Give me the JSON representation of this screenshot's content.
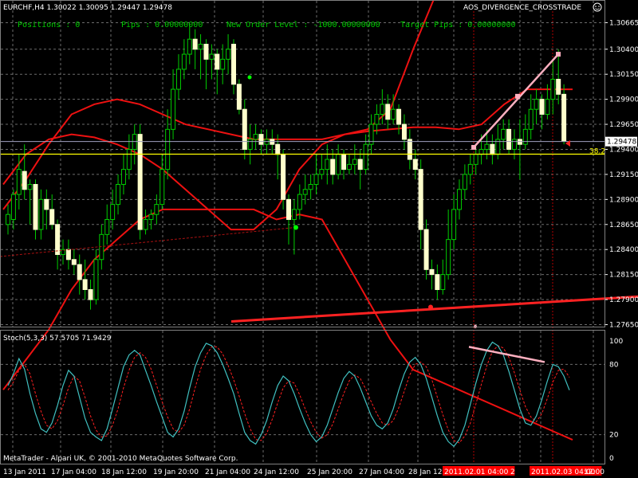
{
  "header": {
    "symbol_info": "EURCHF,H4  1.30022 1.30095 1.29447 1.29478",
    "indicator_name": "AOS_DIVERGENCE_CROSSTRADE",
    "positions": "Positions : 0",
    "pips": "Pips : 0.00000000",
    "new_order_level": "New Order Level : -1000.00000000",
    "target_pips": "Target Pips : 0.00000000"
  },
  "sub_window": {
    "label": "Stoch(5,3,3) 57.5705 71.9429"
  },
  "copyright": "MetaTrader - Alpari UK, © 2001-2010 MetaQuotes Software Corp.",
  "fib_label": "38.2",
  "chart_data": {
    "type": "candlestick",
    "price_axis": {
      "labels": [
        "1.30665",
        "1.30400",
        "1.30150",
        "1.29900",
        "1.29650",
        "1.29400",
        "1.29150",
        "1.28900",
        "1.28650",
        "1.28400",
        "1.28150",
        "1.27900",
        "1.27650"
      ],
      "range": [
        1.2763,
        1.3078
      ]
    },
    "current_price": "1.29478",
    "time_axis": {
      "labels": [
        "13 Jan 2011",
        "17 Jan 04:00",
        "18 Jan 12:00",
        "19 Jan 20:00",
        "21 Jan 04:00",
        "24 Jan 12:00",
        "25 Jan 20:00",
        "27 Jan 04:00",
        "28 Jan 12:00",
        "2011.02.01 04:00",
        "2",
        "2011.02.03 04:00",
        "12:00"
      ],
      "highlighted": [
        "2011.02.01 04:00",
        "2011.02.03 04:00"
      ]
    },
    "stoch_axis": {
      "labels": [
        "100",
        "80",
        "20",
        "0"
      ],
      "range": [
        0,
        100
      ]
    },
    "candles": [
      [
        1.2865,
        1.2875,
        1.2885,
        1.2855
      ],
      [
        1.287,
        1.2895,
        1.29,
        1.286
      ],
      [
        1.2895,
        1.292,
        1.2935,
        1.288
      ],
      [
        1.2918,
        1.29,
        1.2945,
        1.289
      ],
      [
        1.29,
        1.2905,
        1.291,
        1.2865
      ],
      [
        1.2905,
        1.286,
        1.291,
        1.285
      ],
      [
        1.286,
        1.289,
        1.29,
        1.285
      ],
      [
        1.289,
        1.288,
        1.29,
        1.286
      ],
      [
        1.288,
        1.2865,
        1.2895,
        1.286
      ],
      [
        1.2865,
        1.2835,
        1.287,
        1.282
      ],
      [
        1.2835,
        1.284,
        1.285,
        1.2825
      ],
      [
        1.284,
        1.283,
        1.285,
        1.282
      ],
      [
        1.283,
        1.2825,
        1.284,
        1.2815
      ],
      [
        1.2825,
        1.281,
        1.2835,
        1.2795
      ],
      [
        1.281,
        1.28,
        1.283,
        1.279
      ],
      [
        1.28,
        1.279,
        1.281,
        1.278
      ],
      [
        1.279,
        1.283,
        1.284,
        1.2785
      ],
      [
        1.283,
        1.2855,
        1.2865,
        1.282
      ],
      [
        1.2855,
        1.287,
        1.2885,
        1.2845
      ],
      [
        1.287,
        1.2885,
        1.29,
        1.286
      ],
      [
        1.2885,
        1.2905,
        1.2915,
        1.2875
      ],
      [
        1.2905,
        1.292,
        1.2935,
        1.2895
      ],
      [
        1.292,
        1.294,
        1.2955,
        1.291
      ],
      [
        1.294,
        1.2955,
        1.2965,
        1.2925
      ],
      [
        1.2955,
        1.286,
        1.2965,
        1.285
      ],
      [
        1.286,
        1.287,
        1.288,
        1.2855
      ],
      [
        1.287,
        1.2875,
        1.288,
        1.286
      ],
      [
        1.2875,
        1.2885,
        1.2895,
        1.2865
      ],
      [
        1.2885,
        1.292,
        1.2935,
        1.288
      ],
      [
        1.292,
        1.296,
        1.298,
        1.291
      ],
      [
        1.296,
        1.3,
        1.302,
        1.295
      ],
      [
        1.3,
        1.302,
        1.3035,
        1.299
      ],
      [
        1.302,
        1.3035,
        1.305,
        1.301
      ],
      [
        1.3035,
        1.305,
        1.3065,
        1.3025
      ],
      [
        1.305,
        1.304,
        1.306,
        1.302
      ],
      [
        1.304,
        1.3045,
        1.3055,
        1.301
      ],
      [
        1.3045,
        1.303,
        1.305,
        1.3
      ],
      [
        1.303,
        1.3035,
        1.3045,
        1.301
      ],
      [
        1.3035,
        1.302,
        1.304,
        1.2995
      ],
      [
        1.302,
        1.303,
        1.3045,
        1.3005
      ],
      [
        1.303,
        1.304,
        1.3055,
        1.3015
      ],
      [
        1.3045,
        1.3005,
        1.305,
        1.2995
      ],
      [
        1.3005,
        1.298,
        1.301,
        1.2975
      ],
      [
        1.298,
        1.294,
        1.299,
        1.293
      ],
      [
        1.294,
        1.295,
        1.2965,
        1.2925
      ],
      [
        1.295,
        1.2955,
        1.2965,
        1.294
      ],
      [
        1.2955,
        1.2945,
        1.296,
        1.2935
      ],
      [
        1.2945,
        1.295,
        1.296,
        1.2935
      ],
      [
        1.295,
        1.2945,
        1.296,
        1.2935
      ],
      [
        1.2945,
        1.2935,
        1.2955,
        1.291
      ],
      [
        1.2935,
        1.289,
        1.294,
        1.288
      ],
      [
        1.289,
        1.287,
        1.2895,
        1.2845
      ],
      [
        1.287,
        1.288,
        1.289,
        1.2835
      ],
      [
        1.288,
        1.2895,
        1.2905,
        1.287
      ],
      [
        1.2895,
        1.29,
        1.2915,
        1.2885
      ],
      [
        1.29,
        1.2905,
        1.2915,
        1.289
      ],
      [
        1.2905,
        1.2915,
        1.2935,
        1.2895
      ],
      [
        1.2915,
        1.292,
        1.2935,
        1.291
      ],
      [
        1.292,
        1.293,
        1.2945,
        1.2905
      ],
      [
        1.293,
        1.2915,
        1.294,
        1.2905
      ],
      [
        1.2915,
        1.2935,
        1.2945,
        1.291
      ],
      [
        1.2935,
        1.292,
        1.294,
        1.291
      ],
      [
        1.292,
        1.2925,
        1.2935,
        1.2915
      ],
      [
        1.2925,
        1.293,
        1.2945,
        1.2915
      ],
      [
        1.293,
        1.292,
        1.294,
        1.29
      ],
      [
        1.292,
        1.2945,
        1.2955,
        1.2915
      ],
      [
        1.2945,
        1.2965,
        1.2975,
        1.2935
      ],
      [
        1.2965,
        1.2975,
        1.2985,
        1.2955
      ],
      [
        1.2975,
        1.2985,
        1.3,
        1.2965
      ],
      [
        1.2985,
        1.297,
        1.2995,
        1.296
      ],
      [
        1.297,
        1.298,
        1.2995,
        1.2965
      ],
      [
        1.298,
        1.2965,
        1.2985,
        1.2955
      ],
      [
        1.2965,
        1.295,
        1.2975,
        1.294
      ],
      [
        1.295,
        1.293,
        1.296,
        1.292
      ],
      [
        1.293,
        1.292,
        1.294,
        1.291
      ],
      [
        1.292,
        1.286,
        1.293,
        1.284
      ],
      [
        1.286,
        1.282,
        1.287,
        1.281
      ],
      [
        1.282,
        1.2815,
        1.283,
        1.28
      ],
      [
        1.2815,
        1.28,
        1.2825,
        1.279
      ],
      [
        1.28,
        1.2815,
        1.283,
        1.2795
      ],
      [
        1.2815,
        1.285,
        1.288,
        1.281
      ],
      [
        1.285,
        1.288,
        1.2895,
        1.284
      ],
      [
        1.288,
        1.29,
        1.291,
        1.287
      ],
      [
        1.29,
        1.2915,
        1.2925,
        1.289
      ],
      [
        1.2915,
        1.2925,
        1.2935,
        1.2905
      ],
      [
        1.2925,
        1.2935,
        1.2945,
        1.2915
      ],
      [
        1.2935,
        1.294,
        1.2955,
        1.2925
      ],
      [
        1.294,
        1.2945,
        1.296,
        1.293
      ],
      [
        1.2945,
        1.2935,
        1.2955,
        1.2925
      ],
      [
        1.2935,
        1.295,
        1.2965,
        1.293
      ],
      [
        1.295,
        1.296,
        1.297,
        1.294
      ],
      [
        1.296,
        1.294,
        1.297,
        1.2935
      ],
      [
        1.294,
        1.295,
        1.296,
        1.293
      ],
      [
        1.295,
        1.2945,
        1.297,
        1.291
      ],
      [
        1.2945,
        1.296,
        1.2975,
        1.294
      ],
      [
        1.296,
        1.298,
        1.2995,
        1.295
      ],
      [
        1.298,
        1.299,
        1.3,
        1.2965
      ],
      [
        1.299,
        1.2975,
        1.2995,
        1.296
      ],
      [
        1.2975,
        1.299,
        1.3005,
        1.297
      ],
      [
        1.299,
        1.301,
        1.303,
        1.2975
      ],
      [
        1.301,
        1.2995,
        1.304,
        1.2985
      ],
      [
        1.2995,
        1.2948,
        1.3005,
        1.2945
      ]
    ],
    "upper_band": [
      1.288,
      1.291,
      1.2945,
      1.2975,
      1.2985,
      1.299,
      1.2985,
      1.2975,
      1.2965,
      1.296,
      1.2955,
      1.295,
      1.295,
      1.295,
      1.295,
      1.2955,
      1.296,
      1.298,
      1.304,
      1.3095,
      1.315,
      1.32,
      1.325,
      1.331,
      1.336,
      1.342
    ],
    "middle_band": [
      1.2905,
      1.2935,
      1.295,
      1.2955,
      1.2952,
      1.2945,
      1.2935,
      1.292,
      1.29,
      1.288,
      1.286,
      1.286,
      1.288,
      1.292,
      1.2945,
      1.2955,
      1.2958,
      1.296,
      1.2962,
      1.2962,
      1.296,
      1.2965,
      1.2985,
      1.3,
      1.3,
      1.3
    ],
    "lower_band": [
      1.27,
      1.273,
      1.276,
      1.28,
      1.283,
      1.285,
      1.287,
      1.288,
      1.288,
      1.288,
      1.288,
      1.288,
      1.287,
      1.2875,
      1.287,
      1.283,
      1.279,
      1.275,
      1.272,
      1.271,
      1.27,
      1.269,
      1.268,
      1.267,
      1.266,
      1.265
    ],
    "trend_line": [
      [
        0,
        1.2765
      ],
      [
        102,
        1.2793
      ]
    ],
    "divergence_price": [
      [
        78,
        1.2942
      ],
      [
        101,
        1.3035
      ]
    ],
    "divergence_stoch": [
      [
        78,
        95
      ],
      [
        90,
        82
      ]
    ],
    "stoch_main": [
      62,
      72,
      85,
      76,
      55,
      38,
      25,
      22,
      30,
      45,
      62,
      75,
      70,
      52,
      34,
      22,
      18,
      15,
      25,
      42,
      60,
      78,
      88,
      92,
      88,
      75,
      62,
      48,
      35,
      22,
      18,
      25,
      40,
      60,
      78,
      90,
      98,
      96,
      90,
      80,
      68,
      55,
      38,
      22,
      15,
      12,
      20,
      32,
      48,
      62,
      70,
      66,
      55,
      42,
      30,
      20,
      14,
      18,
      28,
      42,
      56,
      68,
      74,
      70,
      60,
      48,
      36,
      28,
      25,
      30,
      42,
      58,
      72,
      82,
      86,
      80,
      68,
      52,
      36,
      22,
      14,
      10,
      16,
      28,
      46,
      64,
      80,
      92,
      99,
      96,
      88,
      74,
      58,
      42,
      30,
      28,
      36,
      50,
      66,
      80,
      78,
      70,
      58
    ],
    "stoch_signal": [
      58,
      65,
      75,
      80,
      72,
      55,
      40,
      28,
      25,
      32,
      45,
      60,
      70,
      66,
      52,
      36,
      24,
      18,
      19,
      28,
      42,
      60,
      75,
      86,
      90,
      86,
      76,
      62,
      48,
      35,
      25,
      22,
      28,
      42,
      60,
      76,
      88,
      95,
      95,
      89,
      79,
      67,
      53,
      38,
      25,
      16,
      15,
      21,
      33,
      47,
      60,
      66,
      64,
      54,
      42,
      31,
      22,
      17,
      20,
      29,
      42,
      55,
      66,
      71,
      68,
      59,
      48,
      38,
      30,
      28,
      32,
      43,
      57,
      71,
      80,
      82,
      78,
      67,
      52,
      37,
      24,
      15,
      13,
      19,
      30,
      46,
      63,
      79,
      91,
      96,
      94,
      86,
      73,
      58,
      44,
      35,
      31,
      38,
      51,
      65,
      75,
      76,
      69
    ]
  }
}
